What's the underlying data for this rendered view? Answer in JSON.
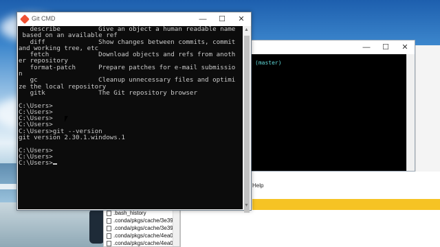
{
  "git_cmd": {
    "title": "Git CMD",
    "lines": [
      "   describe          Give an object a human readable name",
      " based on an available ref",
      "   diff              Show changes between commits, commit",
      "and working tree, etc",
      "   fetch             Download objects and refs from anoth",
      "er repository",
      "   format-patch      Prepare patches for e-mail submissio",
      "n",
      "   gc                Cleanup unnecessary files and optimi",
      "ze the local repository",
      "   gitk              The Git repository browser",
      "",
      "C:\\Users>",
      "C:\\Users>",
      "C:\\Users>",
      "C:\\Users>",
      "C:\\Users>git --version",
      "git version 2.30.1.windows.1",
      "",
      "C:\\Users>",
      "C:\\Users>"
    ],
    "prompt_line": "C:\\Users>"
  },
  "bash_window": {
    "branch_text": "(master)"
  },
  "right_app": {
    "menu_help": "Help"
  },
  "file_list": [
    ".bash_history",
    ".conda/pkgs/cache/3e39",
    ".conda/pkgs/cache/3e39",
    ".conda/pkgs/cache/4ea0",
    ".conda/pkgs/cache/4ea0"
  ],
  "window_controls": {
    "minimize": "—",
    "maximize": "☐",
    "close": "✕"
  },
  "colors": {
    "console_bg": "#0c0c0c",
    "console_fg": "#cccccc",
    "bash_branch": "#5fd7d7",
    "accent_yellow": "#f6c324"
  }
}
